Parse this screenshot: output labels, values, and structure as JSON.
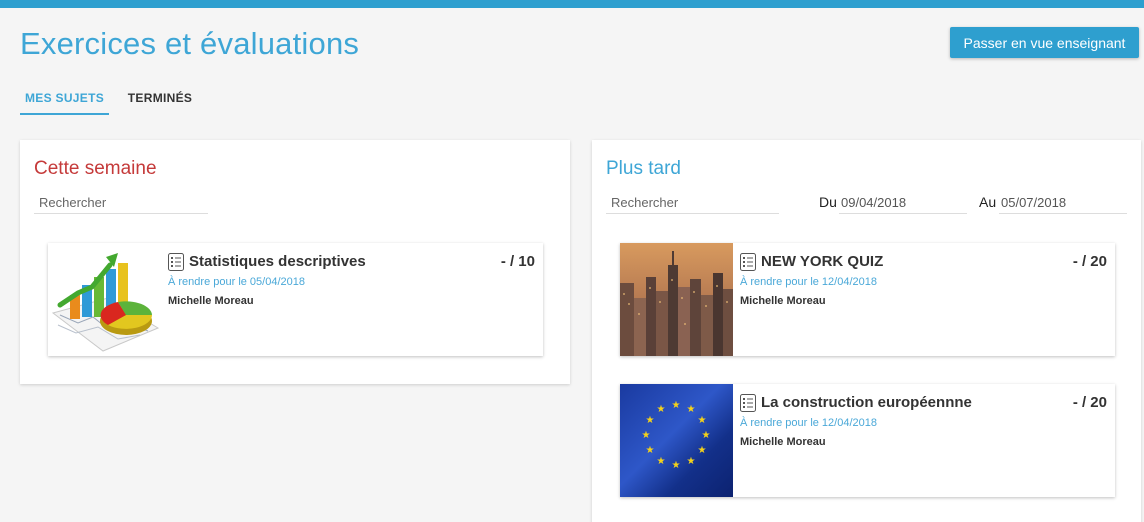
{
  "header": {
    "title": "Exercices et évaluations",
    "teacher_button": "Passer en vue enseignant"
  },
  "tabs": [
    {
      "label": "MES SUJETS",
      "active": true
    },
    {
      "label": "TERMINÉS",
      "active": false
    }
  ],
  "colors": {
    "accent": "#3ea6d6",
    "topbar": "#2e9fcf",
    "this_week_title": "#c53a3a"
  },
  "this_week": {
    "title": "Cette semaine",
    "search_placeholder": "Rechercher",
    "cards": [
      {
        "icon": "checklist-icon",
        "title": "Statistiques descriptives",
        "score": "- / 10",
        "due": "À rendre pour le 05/04/2018",
        "author": "Michelle Moreau",
        "thumbnail": "statistics-chart-image"
      }
    ]
  },
  "later": {
    "title": "Plus tard",
    "search_placeholder": "Rechercher",
    "from_label": "Du",
    "from_value": "09/04/2018",
    "to_label": "Au",
    "to_value": "05/07/2018",
    "cards": [
      {
        "icon": "checklist-icon",
        "title": "NEW YORK QUIZ",
        "score": "- / 20",
        "due": "À rendre pour le 12/04/2018",
        "author": "Michelle Moreau",
        "thumbnail": "new-york-skyline-image"
      },
      {
        "icon": "checklist-icon",
        "title": "La construction européennne",
        "score": "- / 20",
        "due": "À rendre pour le 12/04/2018",
        "author": "Michelle Moreau",
        "thumbnail": "eu-flag-image"
      }
    ]
  }
}
